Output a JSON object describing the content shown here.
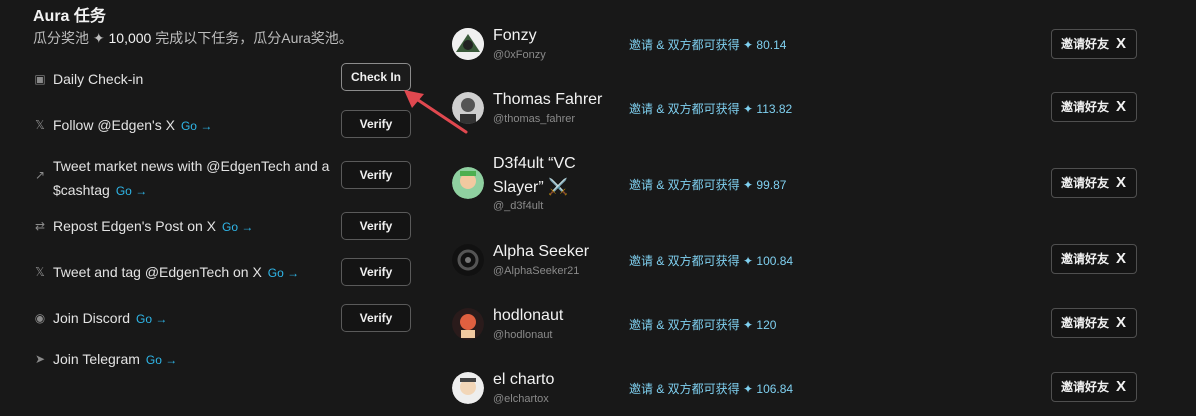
{
  "aura": {
    "title": "Aura 任务",
    "subtitle_prefix": "瓜分奖池 ✦",
    "subtitle_amount": "10,000",
    "subtitle_suffix": "完成以下任务，瓜分Aura奖池。"
  },
  "tasks": [
    {
      "label": "Daily Check-in",
      "go": "",
      "button": "Check In",
      "icon": "calendar-icon"
    },
    {
      "label": "Follow @Edgen's X",
      "go": "Go",
      "button": "Verify",
      "icon": "x-icon"
    },
    {
      "label_line1": "Tweet market news with @EdgenTech and a",
      "label_line2": "$cashtag",
      "go": "Go",
      "button": "Verify",
      "icon": "external-link-icon"
    },
    {
      "label": "Repost Edgen's Post on X",
      "go": "Go",
      "button": "Verify",
      "icon": "repost-icon"
    },
    {
      "label": "Tweet and tag @EdgenTech on X",
      "go": "Go",
      "button": "Verify",
      "icon": "x-icon"
    },
    {
      "label": "Join Discord",
      "go": "Go",
      "button": "Verify",
      "icon": "discord-icon"
    },
    {
      "label": "Join Telegram",
      "go": "Go",
      "icon": "telegram-icon"
    }
  ],
  "go_arrow": "→",
  "reward_prefix": "邀请 & 双方都可获得 ✦",
  "invite_label": "邀请好友",
  "invite_x": "X",
  "users": [
    {
      "name": "Fonzy",
      "handle": "@0xFonzy",
      "reward": "80.14"
    },
    {
      "name": "Thomas Fahrer",
      "handle": "@thomas_fahrer",
      "reward": "113.82"
    },
    {
      "name_line1": "D3f4ult “VC",
      "name_line2": "Slayer” ⚔️",
      "handle": "@_d3f4ult",
      "reward": "99.87"
    },
    {
      "name": "Alpha Seeker",
      "handle": "@AlphaSeeker21",
      "reward": "100.84"
    },
    {
      "name": "hodlonaut",
      "handle": "@hodlonaut",
      "reward": "120"
    },
    {
      "name": "el charto",
      "handle": "@elchartox",
      "reward": "106.84"
    }
  ],
  "colors": {
    "background": "#181818",
    "link": "#2fb6e8",
    "reward": "#7fd0f0",
    "arrow": "#e0484f"
  }
}
